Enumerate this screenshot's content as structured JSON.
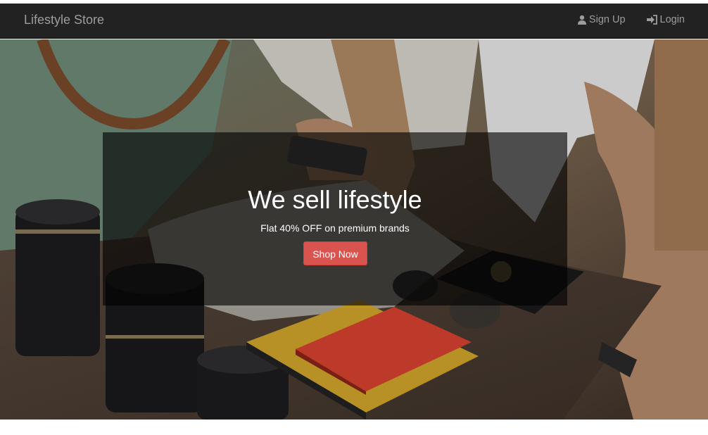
{
  "navbar": {
    "brand": "Lifestyle Store",
    "links": [
      {
        "label": "Sign Up",
        "icon": "user-icon"
      },
      {
        "label": "Login",
        "icon": "login-icon"
      }
    ]
  },
  "hero": {
    "background": "lifestyle-products-photo",
    "title": "We sell lifestyle",
    "subtitle": "Flat 40% OFF on premium brands",
    "cta_label": "Shop Now"
  },
  "colors": {
    "navbar_bg": "#222222",
    "navbar_text": "#9d9d9d",
    "cta_bg": "#d9534f",
    "overlay": "rgba(0,0,0,0.62)"
  }
}
